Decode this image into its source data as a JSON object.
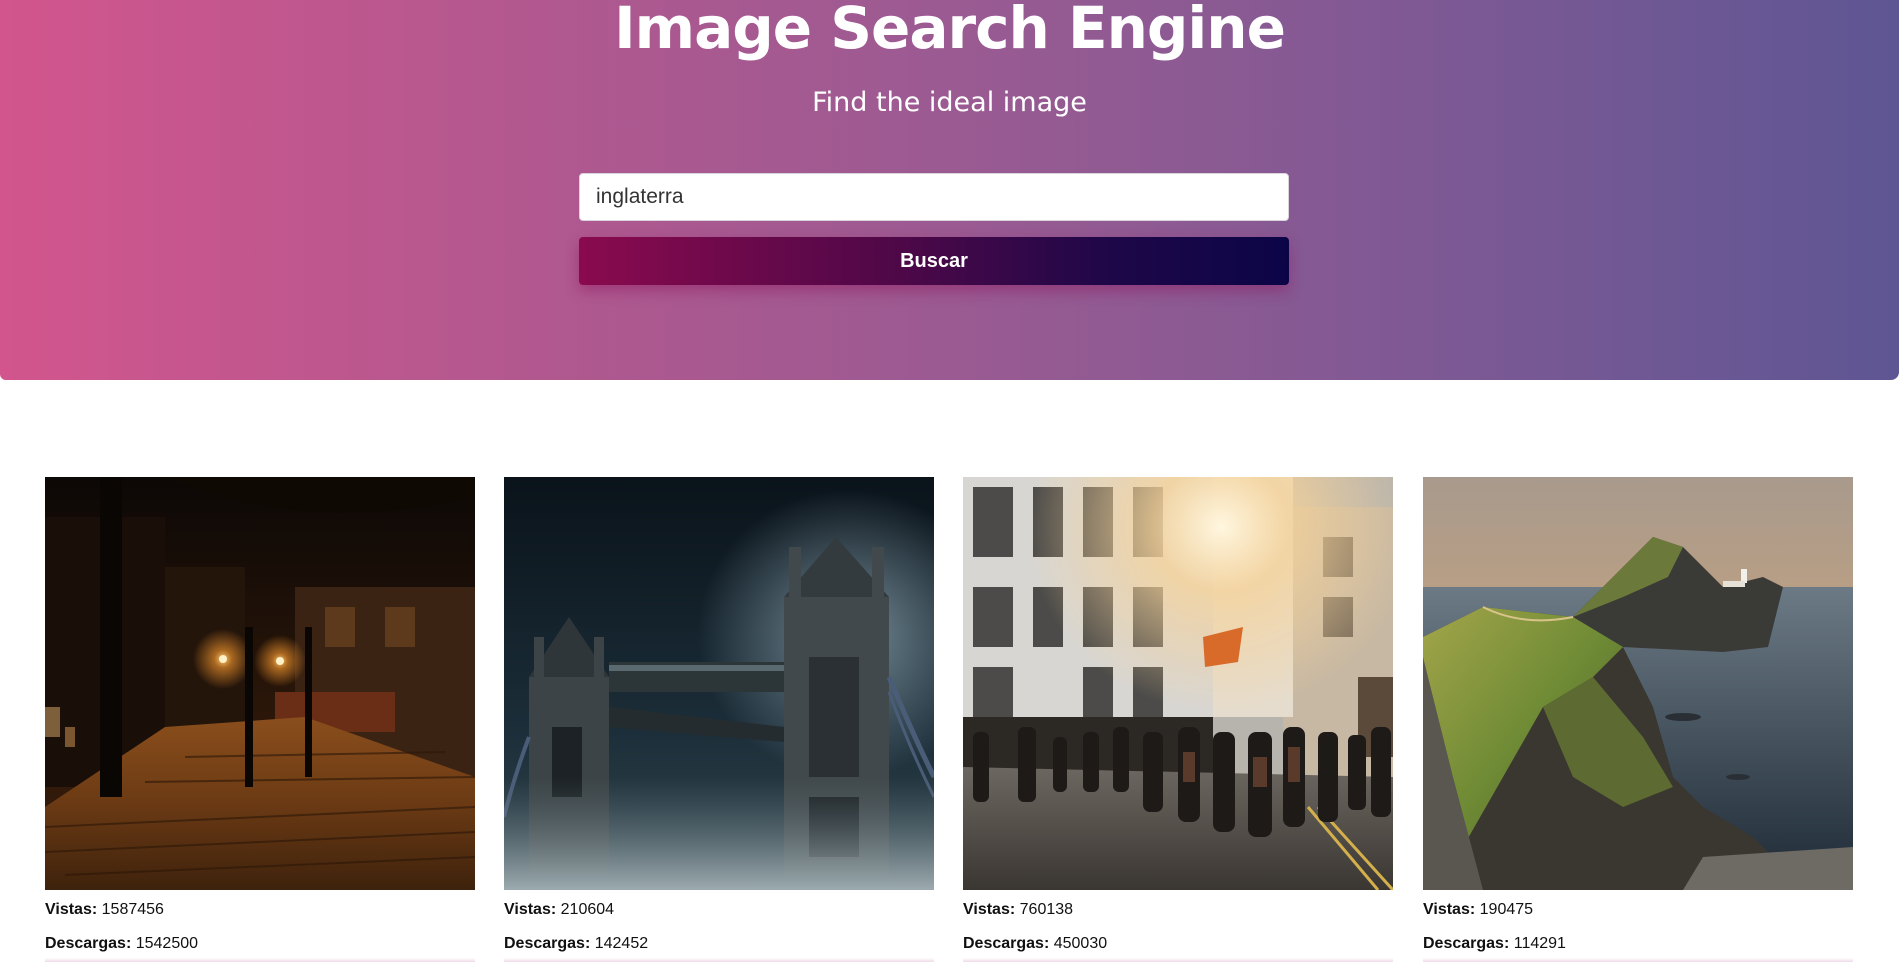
{
  "header": {
    "title": "Image Search Engine",
    "subtitle": "Find the ideal image"
  },
  "search": {
    "value": "inglaterra",
    "button_label": "Buscar"
  },
  "results": [
    {
      "image": "night-cobblestone-street-with-lamps",
      "views_label": "Vistas:",
      "views": "1587456",
      "downloads_label": "Descargas:",
      "downloads": "1542500"
    },
    {
      "image": "tower-bridge-at-night-in-fog",
      "views_label": "Vistas:",
      "views": "210604",
      "downloads_label": "Descargas:",
      "downloads": "142452"
    },
    {
      "image": "crowded-london-street-at-sunset",
      "views_label": "Vistas:",
      "views": "760138",
      "downloads_label": "Descargas:",
      "downloads": "450030"
    },
    {
      "image": "coastal-cliffs-with-lighthouse",
      "views_label": "Vistas:",
      "views": "190475",
      "downloads_label": "Descargas:",
      "downloads": "114291"
    }
  ],
  "colors": {
    "hero_gradient_start": "#d2558d",
    "hero_gradient_end": "#5e5693",
    "button_gradient_start": "#8a0a4e",
    "button_gradient_end": "#0b0547"
  }
}
